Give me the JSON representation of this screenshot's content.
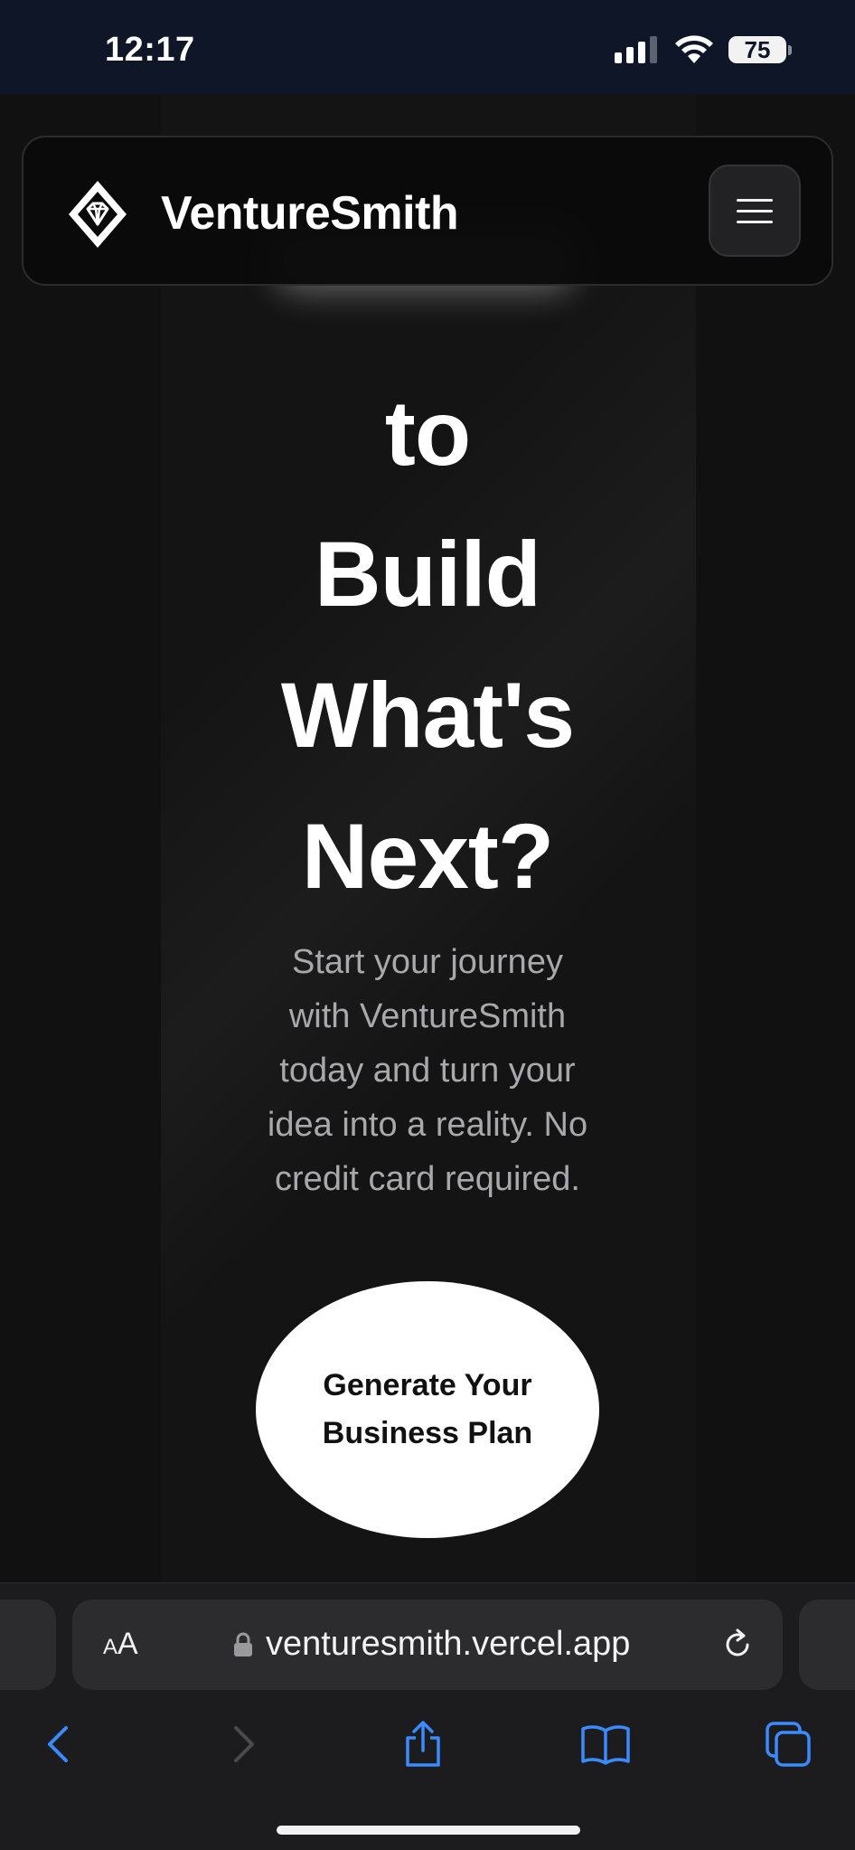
{
  "status_bar": {
    "time": "12:17",
    "battery": "75"
  },
  "header": {
    "brand": "VentureSmith",
    "logo_icon": "diamond-icon",
    "menu_icon": "hamburger-menu-icon"
  },
  "hero": {
    "lines": [
      "to",
      "Build",
      "What's",
      "Next?"
    ],
    "subtitle_lines": [
      "Start your journey",
      "with VentureSmith",
      "today and turn your",
      "idea into a reality. No",
      "credit card required."
    ],
    "cta_label": "Generate Your Business Plan"
  },
  "browser": {
    "text_size_label_small": "A",
    "text_size_label_large": "A",
    "url": "venturesmith.vercel.app",
    "icons": [
      "lock-icon",
      "reload-icon",
      "back-icon",
      "forward-icon",
      "share-icon",
      "bookmarks-icon",
      "tabs-icon"
    ]
  },
  "colors": {
    "status_bg": "#0e1628",
    "page_bg": "#111111",
    "accent_blue": "#3a8bff",
    "cta_bg": "#ffffff"
  }
}
